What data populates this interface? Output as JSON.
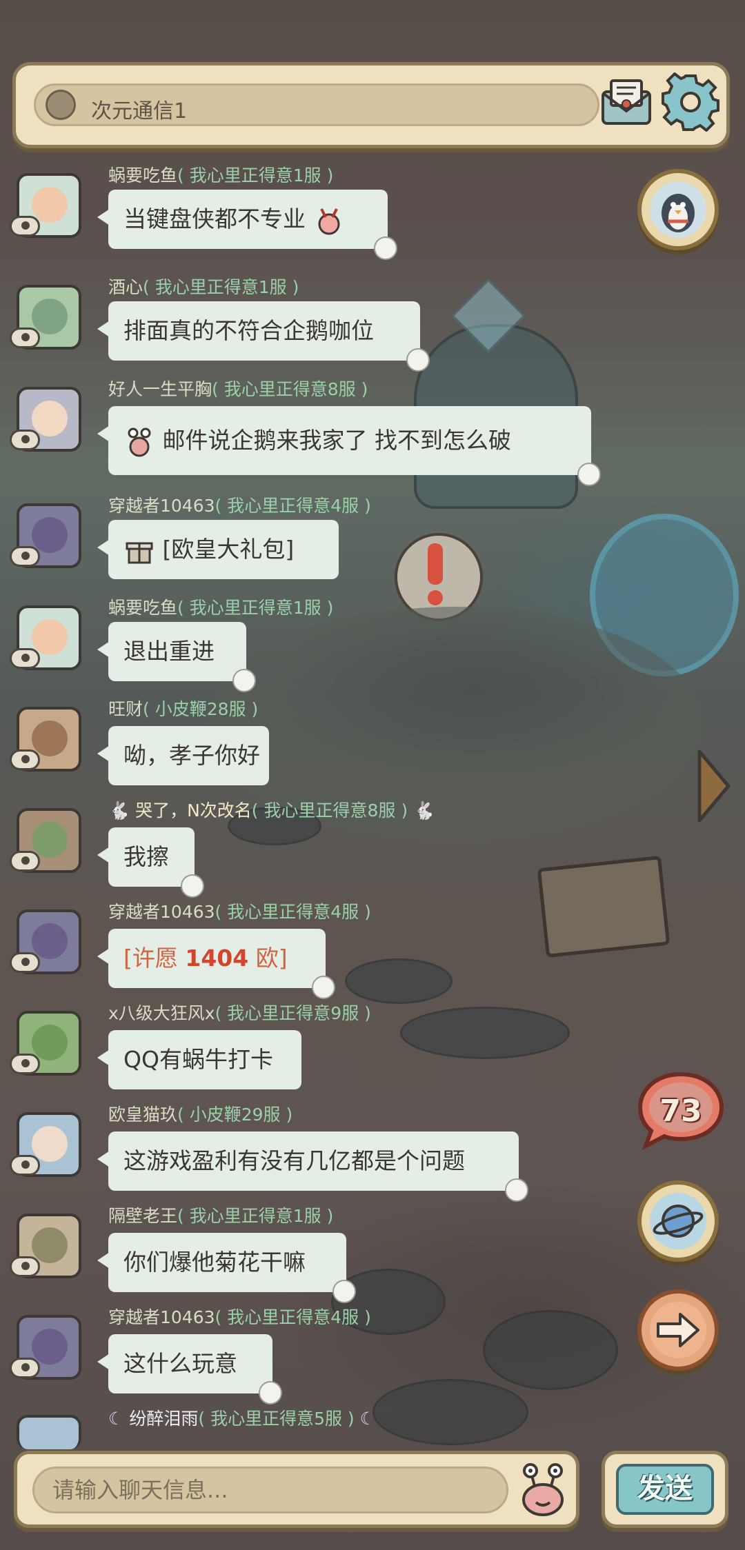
{
  "header": {
    "channel_name": "次元通信1"
  },
  "messages": [
    {
      "name": "蜗要吃鱼",
      "server": "( 我心里正得意1服 )",
      "text": "当键盘侠都不专业",
      "emoji_after": true
    },
    {
      "name": "酒心",
      "server": "( 我心里正得意1服 )",
      "text": "排面真的不符合企鹅咖位"
    },
    {
      "name": "好人一生平胸",
      "server": "( 我心里正得意8服 )",
      "text": "邮件说企鹅来我家了    找不到怎么破",
      "emoji_before": true
    },
    {
      "name": "穿越者10463",
      "server": "( 我心里正得意4服 )",
      "text": "[欧皇大礼包]",
      "gift_icon": true
    },
    {
      "name": "蜗要吃鱼",
      "server": "( 我心里正得意1服 )",
      "text": "退出重进"
    },
    {
      "name": "旺财",
      "server": "( 小皮鞭28服 )",
      "text": "呦，孝子你好"
    },
    {
      "name": "哭了，N次改名",
      "server": "( 我心里正得意8服 )",
      "text": "我擦",
      "rabbit_decor": true
    },
    {
      "name": "穿越者10463",
      "server": "( 我心里正得意4服 )",
      "text_prefix": "[许愿 ",
      "text_number": "1404",
      "text_suffix": " 欧]"
    },
    {
      "name": "x八级大狂风x",
      "server": "( 我心里正得意9服 )",
      "text": "QQ有蜗牛打卡"
    },
    {
      "name": "欧皇猫玖",
      "server": "( 小皮鞭29服 )",
      "text": "这游戏盈利有没有几亿都是个问题"
    },
    {
      "name": "隔壁老王",
      "server": "( 我心里正得意1服 )",
      "text": "你们爆他菊花干嘛"
    },
    {
      "name": "穿越者10463",
      "server": "( 我心里正得意4服 )",
      "text": "这什么玩意"
    },
    {
      "name": "纷醉泪雨",
      "server": "( 我心里正得意5服 )",
      "moon_decor": true
    }
  ],
  "side": {
    "notification_count": "73"
  },
  "composer": {
    "placeholder": "请输入聊天信息...",
    "send_label": "发送"
  },
  "colors": {
    "bubble": "#e4eee6",
    "name": "#d9ddc4",
    "server": "#9bd1a9",
    "panel": "#efe1bf",
    "send": "#86c6c8"
  }
}
